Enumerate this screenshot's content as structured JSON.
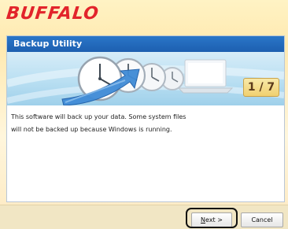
{
  "brand": {
    "logo_text": "BUFFALO",
    "logo_color": "#e2242b"
  },
  "panel": {
    "title": "Backup Utility",
    "title_bar_color": "#2a76c8",
    "step_indicator": "1 / 7",
    "message_line1": "This software will back up your data. Some system files",
    "message_line2": "will not be backed up because Windows is running."
  },
  "banner": {
    "illustration": "clocks-arrow-laptop-illustration"
  },
  "buttons": {
    "next_accel": "N",
    "next_rest": "ext >",
    "cancel": "Cancel"
  }
}
